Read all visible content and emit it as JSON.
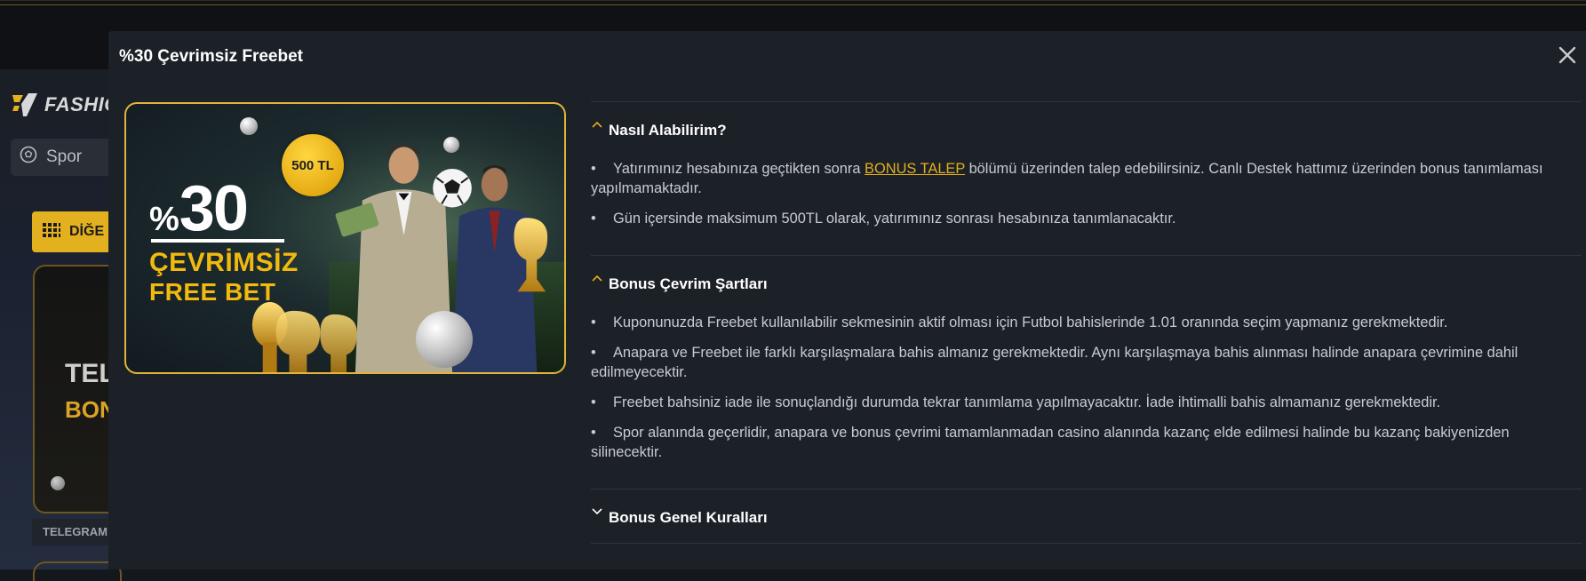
{
  "background": {
    "logo_text": "FASHIO",
    "search_label": "Spor",
    "category_label": "DİĞE",
    "card_title_1": "TEL",
    "card_title_2": "BON",
    "card_label": "TELEGRAM"
  },
  "modal": {
    "title": "%30 Çevrimsiz Freebet",
    "close_icon": "close-icon"
  },
  "banner": {
    "percent_symbol": "%",
    "percent_value": "30",
    "line1": "ÇEVRİMSİZ",
    "line2": "FREE BET",
    "badge": "500 TL"
  },
  "sections": [
    {
      "title": "Nasıl Alabilirim?",
      "expanded": true,
      "items": [
        {
          "before": "Yatırımınız hesabınıza geçtikten sonra ",
          "link": "BONUS TALEP",
          "after": " bölümü üzerinden talep edebilirsiniz. Canlı Destek hattımız üzerinden bonus tanımlaması yapılmamaktadır."
        },
        {
          "text": "Gün içersinde maksimum 500TL olarak, yatırımınız sonrası hesabınıza tanımlanacaktır."
        }
      ]
    },
    {
      "title": "Bonus Çevrim Şartları",
      "expanded": true,
      "items": [
        {
          "text": "Kuponunuzda Freebet kullanılabilir sekmesinin aktif olması için Futbol bahislerinde 1.01 oranında seçim yapmanız gerekmektedir."
        },
        {
          "text": "Anapara ve Freebet ile farklı karşılaşmalara bahis almanız gerekmektedir. Aynı karşılaşmaya bahis alınması halinde anapara çevrimine dahil edilmeyecektir."
        },
        {
          "text": "Freebet bahsiniz iade ile sonuçlandığı durumda tekrar tanımlama yapılmayacaktır. İade ihtimalli bahis almamanız gerekmektedir."
        },
        {
          "text": "Spor alanında geçerlidir, anapara ve bonus çevrimi tamamlanmadan casino alanında kazanç elde edilmesi halinde bu kazanç bakiyenizden silinecektir."
        }
      ]
    },
    {
      "title": "Bonus Genel Kuralları",
      "expanded": false,
      "items": []
    }
  ],
  "colors": {
    "accent": "#e3b01f",
    "modal_bg": "#1c2027",
    "text": "#c8ccd2"
  }
}
